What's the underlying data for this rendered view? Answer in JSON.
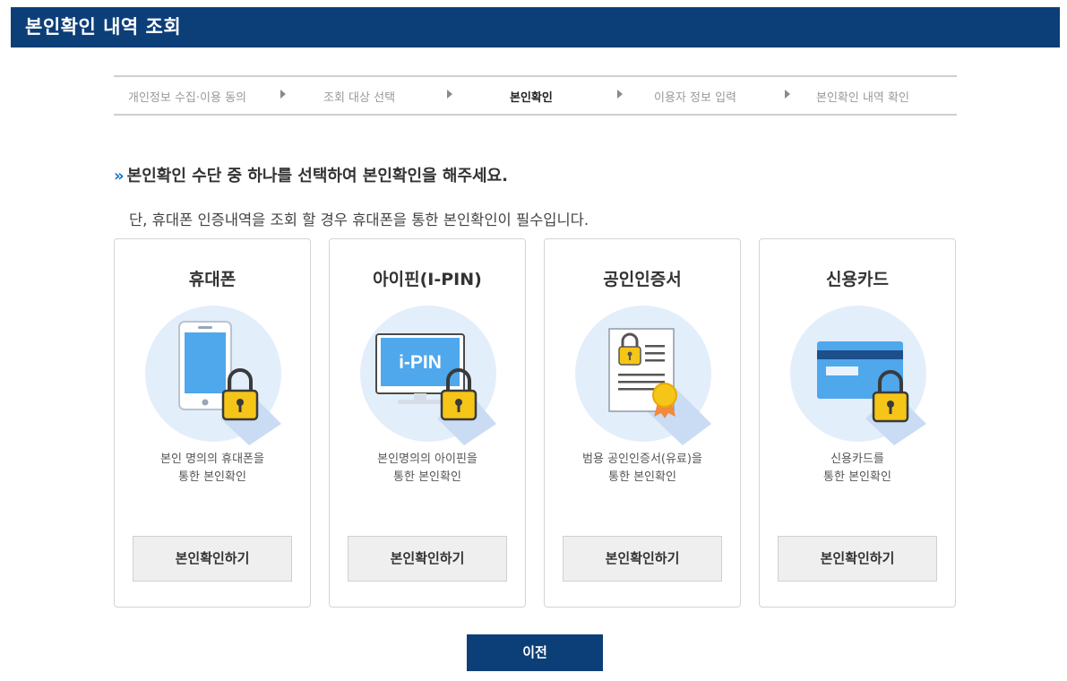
{
  "page": {
    "title": "본인확인 내역 조회"
  },
  "steps": [
    {
      "label": "개인정보 수집·이용 동의",
      "active": false
    },
    {
      "label": "조회 대상 선택",
      "active": false
    },
    {
      "label": "본인확인",
      "active": true
    },
    {
      "label": "이용자 정보 입력",
      "active": false
    },
    {
      "label": "본인확인 내역 확인",
      "active": false
    }
  ],
  "main": {
    "headline": "본인확인 수단 중 하나를 선택하여 본인확인을 해주세요.",
    "subline": "단, 휴대폰 인증내역을 조회 할 경우 휴대폰을 통한 본인확인이 필수입니다."
  },
  "methods": [
    {
      "title": "휴대폰",
      "icon": "mobile-phone-lock-icon",
      "icon_text": "",
      "desc1": "본인 명의의 휴대폰을",
      "desc2": "통한 본인확인",
      "button": "본인확인하기"
    },
    {
      "title": "아이핀(I-PIN)",
      "icon": "ipin-monitor-lock-icon",
      "icon_text": "i-PIN",
      "desc1": "본인명의의 아이핀을",
      "desc2": "통한 본인확인",
      "button": "본인확인하기"
    },
    {
      "title": "공인인증서",
      "icon": "certificate-lock-icon",
      "icon_text": "",
      "desc1": "범용 공인인증서(유료)을",
      "desc2": "통한 본인확인",
      "button": "본인확인하기"
    },
    {
      "title": "신용카드",
      "icon": "credit-card-lock-icon",
      "icon_text": "",
      "desc1": "신용카드를",
      "desc2": "통한 본인확인",
      "button": "본인확인하기"
    }
  ],
  "footer": {
    "prev_button": "이전"
  },
  "colors": {
    "brand_navy": "#0c3e78",
    "accent_blue": "#1a73c9",
    "lock_yellow": "#f5c518",
    "icon_circle": "#e3eefb"
  }
}
